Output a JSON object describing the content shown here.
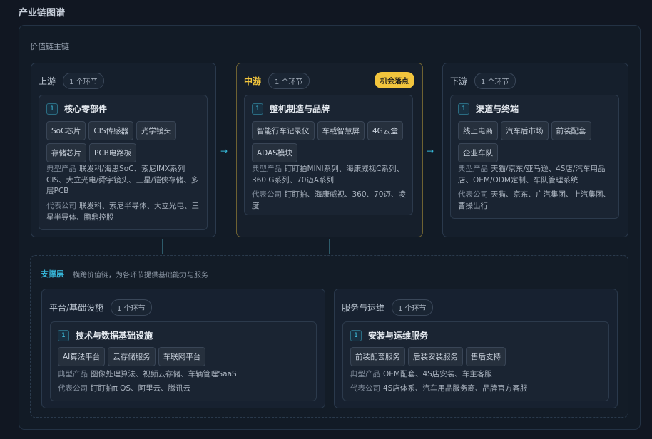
{
  "page_title": "产业链图谱",
  "main_chain_label": "价值链主链",
  "stages": [
    {
      "name": "上游",
      "count": "1 个环节",
      "card": {
        "num": "1",
        "title": "核心零部件",
        "tags": [
          "SoC芯片",
          "CIS传感器",
          "光学镜头",
          "存储芯片",
          "PCB电路板"
        ],
        "products_label": "典型产品",
        "products": "联发科/海思SoC、索尼IMX系列CIS、大立光电/舜宇镜头、三星/铠侠存储、多层PCB",
        "companies_label": "代表公司",
        "companies": "联发科、索尼半导体、大立光电、三星半导体、鹏鼎控股"
      }
    },
    {
      "name": "中游",
      "count": "1 个环节",
      "badge": "机会落点",
      "card": {
        "num": "1",
        "title": "整机制造与品牌",
        "tags": [
          "智能行车记录仪",
          "车载智慧屏",
          "4G云盒",
          "ADAS模块"
        ],
        "products_label": "典型产品",
        "products": "盯盯拍MINI系列、海康威视C系列、360 G系列、70迈A系列",
        "companies_label": "代表公司",
        "companies": "盯盯拍、海康威视、360、70迈、凌度"
      }
    },
    {
      "name": "下游",
      "count": "1 个环节",
      "card": {
        "num": "1",
        "title": "渠道与终端",
        "tags": [
          "线上电商",
          "汽车后市场",
          "前装配套",
          "企业车队"
        ],
        "products_label": "典型产品",
        "products": "天猫/京东/亚马逊、4S店/汽车用品店、OEM/ODM定制、车队管理系统",
        "companies_label": "代表公司",
        "companies": "天猫、京东、广汽集团、上汽集团、曹操出行"
      }
    }
  ],
  "support": {
    "title": "支撑层",
    "description": "横跨价值链，为各环节提供基础能力与服务",
    "groups": [
      {
        "name": "平台/基础设施",
        "count": "1 个环节",
        "card": {
          "num": "1",
          "title": "技术与数据基础设施",
          "tags": [
            "AI算法平台",
            "云存储服务",
            "车联网平台"
          ],
          "products_label": "典型产品",
          "products": "图像处理算法、视频云存储、车辆管理SaaS",
          "companies_label": "代表公司",
          "companies": "盯盯拍π OS、阿里云、腾讯云"
        }
      },
      {
        "name": "服务与运维",
        "count": "1 个环节",
        "card": {
          "num": "1",
          "title": "安装与运维服务",
          "tags": [
            "前装配套服务",
            "后装安装服务",
            "售后支持"
          ],
          "products_label": "典型产品",
          "products": "OEM配套、4S店安装、车主客服",
          "companies_label": "代表公司",
          "companies": "4S店体系、汽车用品服务商、品牌官方客服"
        }
      }
    ]
  },
  "icons": {
    "flow_arrow": "→"
  }
}
